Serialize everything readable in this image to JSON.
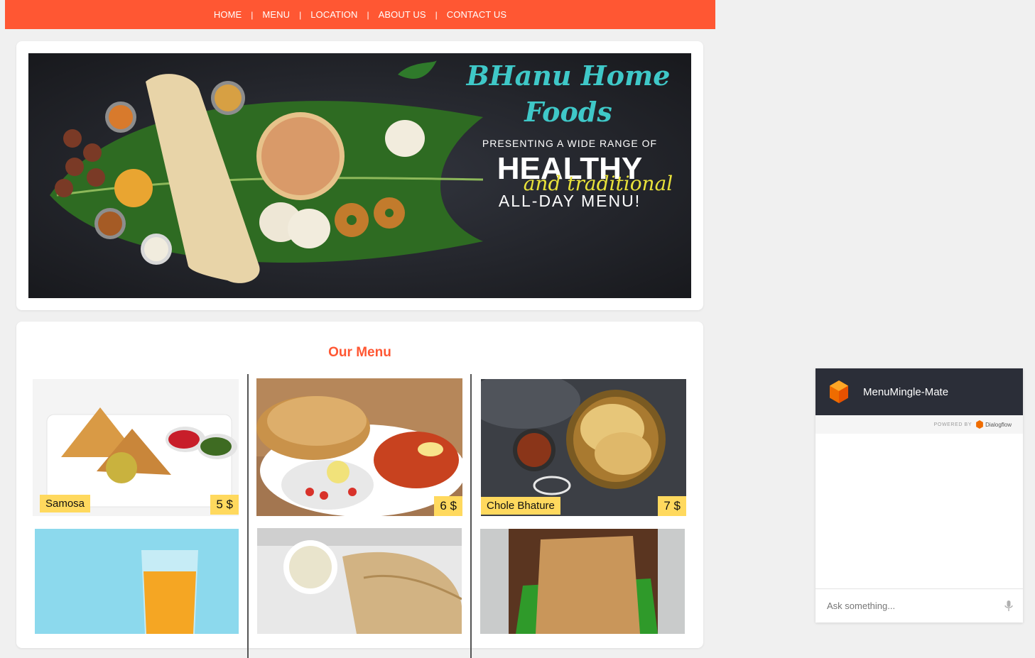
{
  "nav": {
    "items": [
      {
        "label": "HOME"
      },
      {
        "label": "MENU"
      },
      {
        "label": "LOCATION"
      },
      {
        "label": "ABOUT US"
      },
      {
        "label": "CONTACT US"
      }
    ],
    "separator": "|"
  },
  "hero": {
    "brand_line1": "BHanu Home",
    "brand_line2": "Foods",
    "tagline_top": "PRESENTING A WIDE RANGE OF",
    "tagline_big": "HEALTHY",
    "tagline_script": "and traditional",
    "tagline_bottom": "ALL-DAY MENU!"
  },
  "menu": {
    "title": "Our Menu",
    "items": [
      {
        "name": "Samosa",
        "price": "5 $",
        "image": "samosa-image"
      },
      {
        "name": "",
        "price": "6 $",
        "image": "pav-bhaji-image"
      },
      {
        "name": "Chole Bhature",
        "price": "7 $",
        "image": "chole-bhature-image"
      },
      {
        "name": "",
        "price": "",
        "image": "mango-juice-image"
      },
      {
        "name": "",
        "price": "",
        "image": "masala-dosa-image"
      },
      {
        "name": "",
        "price": "",
        "image": "paratha-image"
      }
    ]
  },
  "chat": {
    "title": "MenuMingle-Mate",
    "powered_by": "POWERED BY",
    "brand": "Dialogflow",
    "input_placeholder": "Ask something..."
  },
  "colors": {
    "nav_bg": "#ff5733",
    "menu_title": "#ff5733",
    "tag_bg": "#ffd95e",
    "chat_header": "#2b2e38",
    "hero_brand": "#3fc8c8",
    "hero_script": "#e9e23a"
  }
}
